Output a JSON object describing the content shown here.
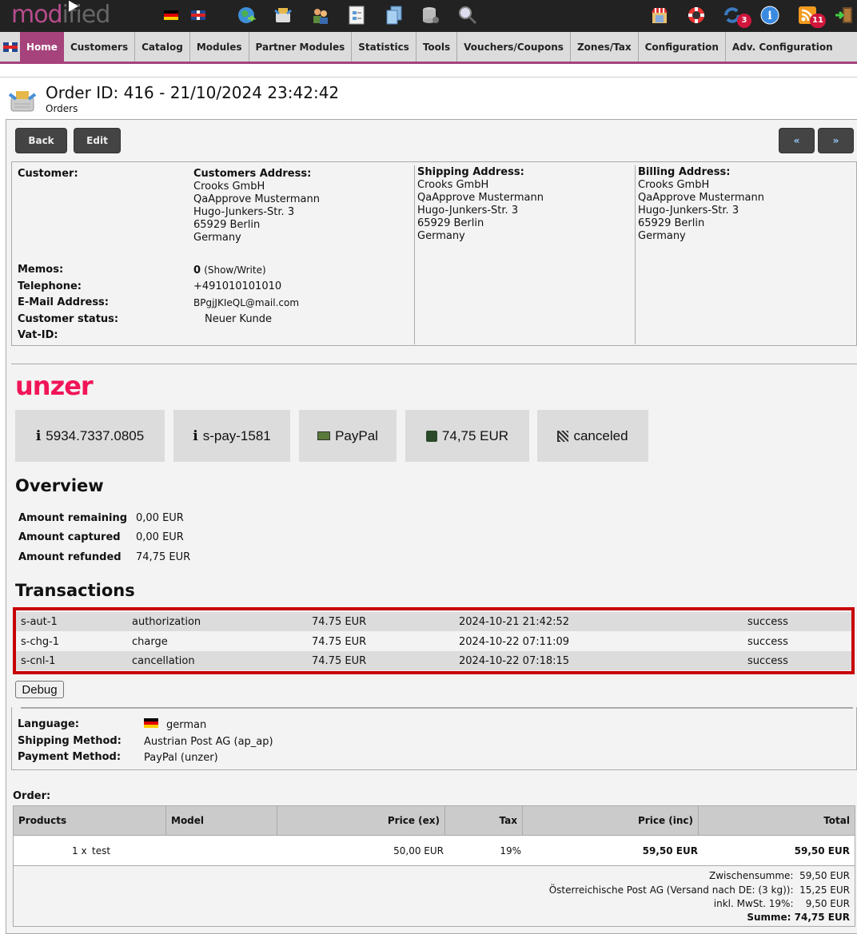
{
  "topbar": {
    "logo_a": "mod",
    "logo_b": "ified",
    "icons": [
      "flag-de-icon",
      "flag-uk-icon",
      "globe-icon",
      "orders-icon",
      "customers-icon",
      "content-icon",
      "documents-icon",
      "database-icon",
      "search-icon"
    ],
    "right_icons": [
      "shop-icon",
      "help-icon",
      "update-icon",
      "info-icon",
      "rss-icon",
      "logout-icon"
    ],
    "update_badge": "3",
    "rss_badge": "11"
  },
  "nav": {
    "items": [
      "Home",
      "Customers",
      "Catalog",
      "Modules",
      "Partner Modules",
      "Statistics",
      "Tools",
      "Vouchers/Coupons",
      "Zones/Tax",
      "Configuration",
      "Adv. Configuration"
    ],
    "active": "Home",
    "accent": "#a6427c"
  },
  "page": {
    "title": "Order ID: 416 - 21/10/2024 23:42:42",
    "subtitle": "Orders"
  },
  "buttons": {
    "back": "Back",
    "edit": "Edit",
    "prev": "«",
    "next": "»"
  },
  "customer": {
    "customer_label": "Customer:",
    "address_label": "Customers Address:",
    "address": [
      "Crooks GmbH",
      "QaApprove Mustermann",
      "Hugo-Junkers-Str. 3",
      "65929 Berlin",
      "Germany"
    ],
    "memos_label": "Memos:",
    "memos_count": "0",
    "memos_link": "(Show/Write)",
    "telephone_label": "Telephone:",
    "telephone": "+491010101010",
    "email_label": "E-Mail Address:",
    "email": "BPgjJKIeQL@mail.com",
    "status_label": "Customer status:",
    "status": "Neuer Kunde",
    "vat_label": "Vat-ID:",
    "vat": ""
  },
  "shipping": {
    "label": "Shipping Address:",
    "lines": [
      "Crooks GmbH",
      "QaApprove Mustermann",
      "Hugo-Junkers-Str. 3",
      "65929 Berlin",
      "Germany"
    ]
  },
  "billing": {
    "label": "Billing Address:",
    "lines": [
      "Crooks GmbH",
      "QaApprove Mustermann",
      "Hugo-Junkers-Str. 3",
      "65929 Berlin",
      "Germany"
    ]
  },
  "unzer": {
    "logo": "unzer",
    "brand_color": "#f11558",
    "tiles": [
      {
        "icon": "info-icon",
        "text": "5934.7337.0805"
      },
      {
        "icon": "info-icon",
        "text": "s-pay-1581"
      },
      {
        "icon": "payment-icon",
        "text": "PayPal"
      },
      {
        "icon": "money-icon",
        "text": "74,75 EUR"
      },
      {
        "icon": "flag-icon",
        "text": "canceled"
      }
    ],
    "overview_title": "Overview",
    "overview": [
      {
        "label": "Amount remaining",
        "value": "0,00 EUR"
      },
      {
        "label": "Amount captured",
        "value": "0,00 EUR"
      },
      {
        "label": "Amount refunded",
        "value": "74,75 EUR"
      }
    ],
    "transactions_title": "Transactions",
    "transactions": [
      {
        "id": "s-aut-1",
        "type": "authorization",
        "amount": "74.75 EUR",
        "date": "2024-10-21 21:42:52",
        "status": "success"
      },
      {
        "id": "s-chg-1",
        "type": "charge",
        "amount": "74.75 EUR",
        "date": "2024-10-22 07:11:09",
        "status": "success"
      },
      {
        "id": "s-cnl-1",
        "type": "cancellation",
        "amount": "74.75 EUR",
        "date": "2024-10-22 07:18:15",
        "status": "success"
      }
    ],
    "debug_label": "Debug"
  },
  "meta": {
    "language_label": "Language:",
    "language": "german",
    "shipping_label": "Shipping Method:",
    "shipping": "Austrian Post AG (ap_ap)",
    "payment_label": "Payment Method:",
    "payment": "PayPal (unzer)"
  },
  "order": {
    "label": "Order:",
    "columns": [
      "Products",
      "Model",
      "Price (ex)",
      "Tax",
      "Price (inc)",
      "Total"
    ],
    "rows": [
      {
        "qty": "1 x",
        "name": "test",
        "model": "",
        "price_ex": "50,00 EUR",
        "tax": "19%",
        "price_inc": "59,50 EUR",
        "total": "59,50 EUR"
      }
    ],
    "totals": [
      {
        "label": "Zwischensumme:",
        "value": "59,50 EUR"
      },
      {
        "label": "Österreichische Post AG (Versand nach DE: (3 kg)):",
        "value": "15,25 EUR"
      },
      {
        "label": "inkl. MwSt. 19%:",
        "value": "9,50 EUR"
      },
      {
        "label": "Summe:",
        "value": "74,75 EUR"
      }
    ]
  }
}
